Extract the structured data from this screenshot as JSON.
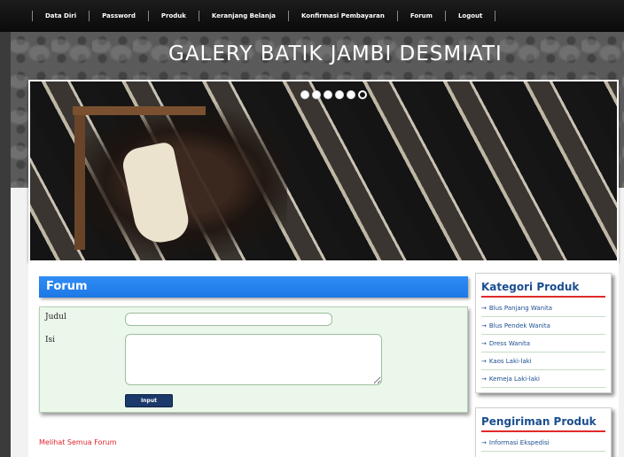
{
  "nav": {
    "items": [
      {
        "label": "Data Diri"
      },
      {
        "label": "Password"
      },
      {
        "label": "Produk"
      },
      {
        "label": "Keranjang Belanja"
      },
      {
        "label": "Konfirmasi Pembayaran"
      },
      {
        "label": "Forum"
      },
      {
        "label": "Logout"
      }
    ]
  },
  "header": {
    "title": "GALERY BATIK JAMBI DESMIATI"
  },
  "banner": {
    "slide_count": 6,
    "active_slide": 6
  },
  "forum": {
    "heading": "Forum",
    "fields": {
      "judul_label": "Judul",
      "judul_value": "",
      "isi_label": "Isi",
      "isi_value": ""
    },
    "submit_label": "Input",
    "view_all_link": "Melihat Semua Forum"
  },
  "sidebar": {
    "categories": {
      "title": "Kategori Produk",
      "items": [
        {
          "label": "Blus Panjang Wanita"
        },
        {
          "label": "Blus Pendek Wanita"
        },
        {
          "label": "Dress Wanita"
        },
        {
          "label": "Kaos Laki-laki"
        },
        {
          "label": "Kemeja Laki-laki"
        }
      ]
    },
    "shipping": {
      "title": "Pengiriman Produk",
      "items": [
        {
          "label": "Informasi Ekspedisi"
        }
      ]
    }
  },
  "colors": {
    "nav_bg": "#111111",
    "forum_header": "#1d78e6",
    "link_red": "#e0242b",
    "sidebar_title": "#1b4e8f",
    "accent_underline": "#e02a2a"
  }
}
